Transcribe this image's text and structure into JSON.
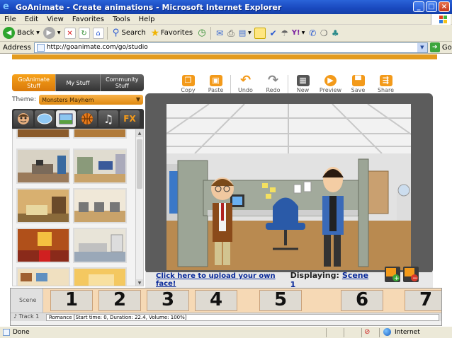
{
  "window": {
    "title": "GoAnimate - Create animations - Microsoft Internet Explorer"
  },
  "menu": [
    "File",
    "Edit",
    "View",
    "Favorites",
    "Tools",
    "Help"
  ],
  "toolbar": {
    "back": "Back",
    "search": "Search",
    "favorites": "Favorites"
  },
  "address": {
    "label": "Address",
    "url": "http://goanimate.com/go/studio",
    "go": "Go"
  },
  "library": {
    "tabs": [
      "GoAnimate Stuff",
      "My Stuff",
      "Community Stuff"
    ],
    "theme_label": "Theme:",
    "theme_value": "Monsters Mayhem",
    "category_fx": "FX"
  },
  "actions": [
    "Copy",
    "Paste",
    "Undo",
    "Redo",
    "New",
    "Preview",
    "Save",
    "Share"
  ],
  "stage": {
    "upload_link": "Click here to upload your own face!",
    "displaying_label": "Displaying:",
    "scene_name": "Scene 1"
  },
  "timeline": {
    "scene_label": "Scene",
    "scene_numbers": [
      "1",
      "2",
      "3",
      "4",
      "5",
      "6",
      "7"
    ],
    "track_label": "Track 1",
    "sound_info": "Romance [Start time: 0, Duration: 22.4, Volume: 100%]"
  },
  "status": {
    "left": "Done",
    "zone": "Internet"
  },
  "colors": {
    "accent_orange": "#f39a1a",
    "xp_blue": "#1a4ac0",
    "link_blue": "#0a2a9a"
  }
}
